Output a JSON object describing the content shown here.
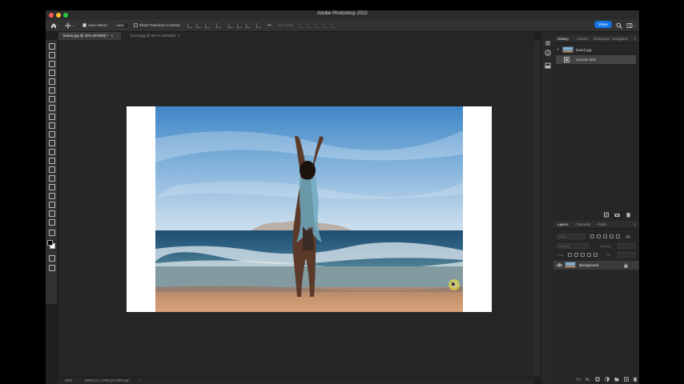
{
  "window": {
    "title": "Adobe Photoshop 2022",
    "traffic_colors": [
      "#ff5f57",
      "#febc2e",
      "#28c840"
    ]
  },
  "options_bar": {
    "auto_select_label": "Auto-Select:",
    "auto_select_value": "Layer",
    "transform_controls_label": "Show Transform Controls",
    "mode_3d_label": "3D Mode:",
    "share_label": "Share"
  },
  "tabs": [
    {
      "label": "beach.jpg @ 25% (RGB/8) *",
      "close": "×"
    },
    {
      "label": "forest.jpg @ 66.7% (RGB/8)",
      "close": "×"
    }
  ],
  "status": {
    "zoom": "25%",
    "doc_info": "6000 px x 4763 px (300 ppi)",
    "arrow": "›"
  },
  "history_panel": {
    "tabs": [
      "History",
      "Actions",
      "Histogram",
      "Navigator"
    ],
    "items": [
      {
        "label": "beach.jpg",
        "type": "snapshot"
      },
      {
        "label": "Canvas Size",
        "type": "step"
      }
    ]
  },
  "layers_panel": {
    "tabs": [
      "Layers",
      "Channels",
      "Paths"
    ],
    "search_placeholder": "Kind",
    "blend_mode": "Normal",
    "opacity_label": "Opacity:",
    "lock_label": "Lock:",
    "fill_label": "Fill:",
    "layers": [
      {
        "name": "Background",
        "visible": true,
        "locked": true
      }
    ]
  },
  "colors": {
    "accent": "#1473e6",
    "app_bg": "#1f1f1f",
    "panel_bg": "#262626"
  }
}
